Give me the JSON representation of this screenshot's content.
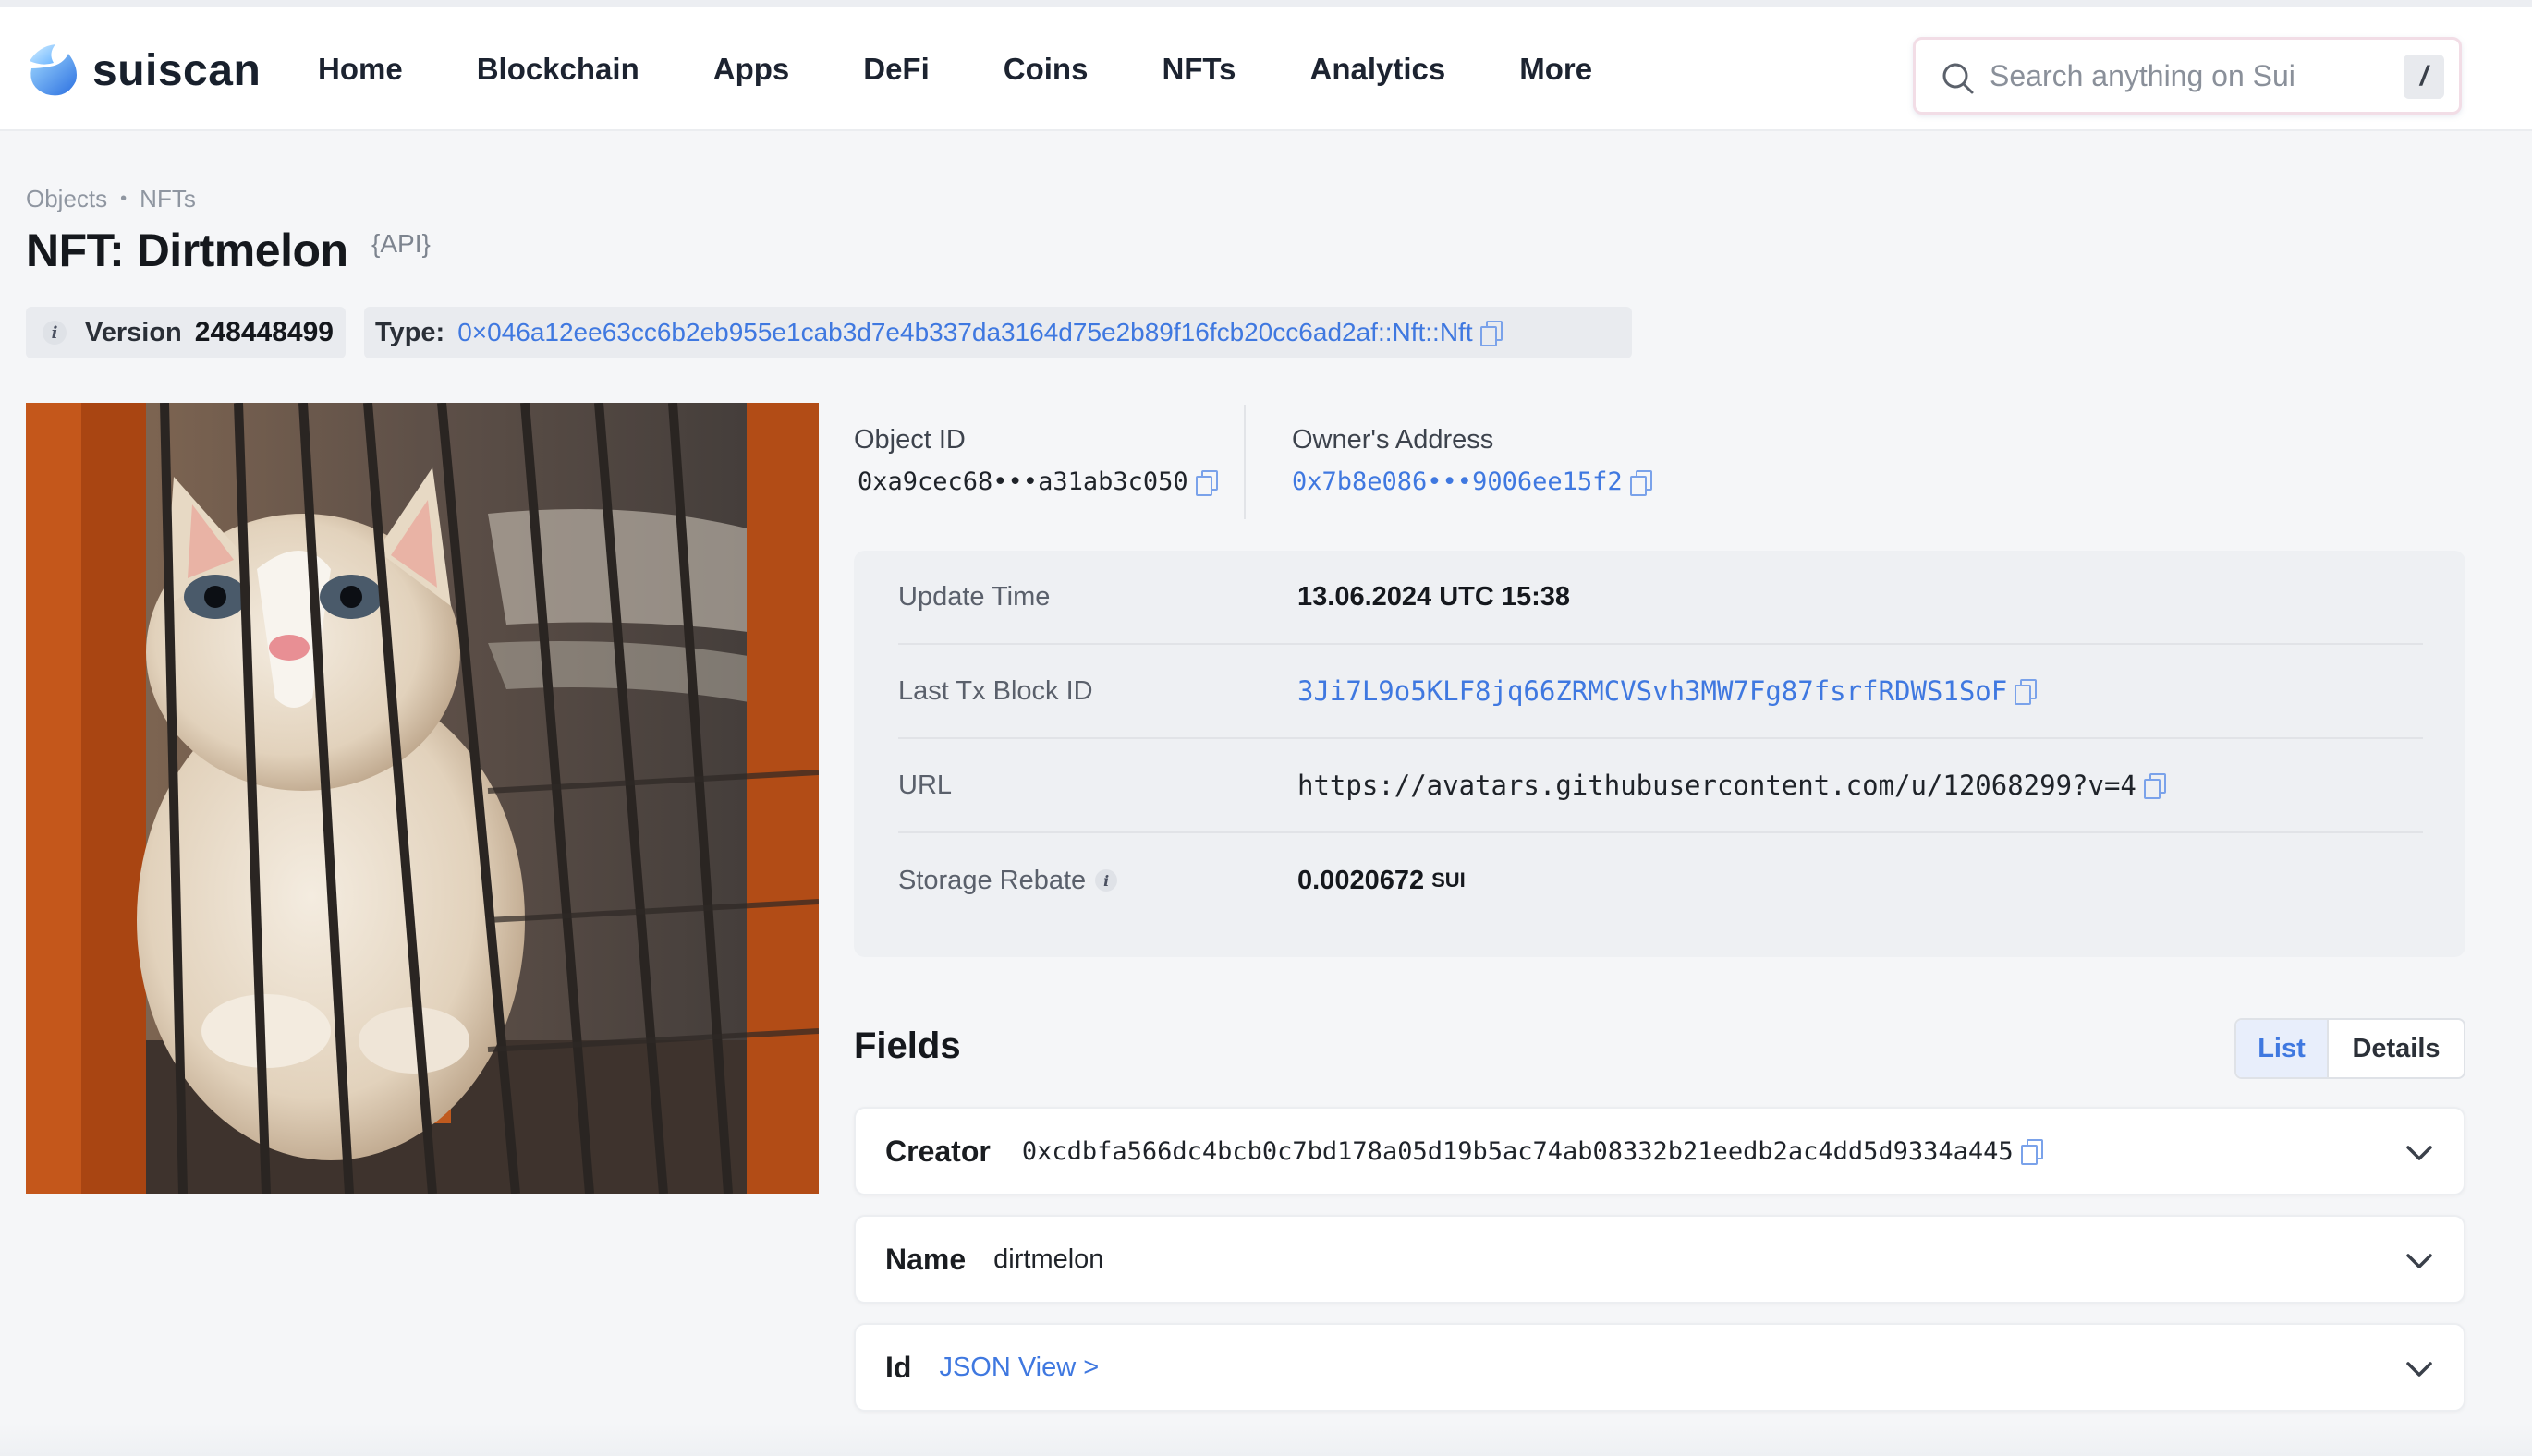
{
  "brand": {
    "name": "suiscan",
    "accent": "#3f78e0"
  },
  "nav": [
    "Home",
    "Blockchain",
    "Apps",
    "DeFi",
    "Coins",
    "NFTs",
    "Analytics",
    "More"
  ],
  "search": {
    "placeholder": "Search anything on Sui",
    "shortcut": "/"
  },
  "breadcrumb": [
    "Objects",
    "NFTs"
  ],
  "page": {
    "title": "NFT: Dirtmelon",
    "api_tag": "{API}"
  },
  "version": {
    "label": "Version",
    "value": "248448499"
  },
  "type": {
    "label": "Type:",
    "value": "0×046a12ee63cc6b2eb955e1cab3d7e4b337da3164d75e2b89f16fcb20cc6ad2af::Nft::Nft"
  },
  "object": {
    "label": "Object ID",
    "value": "0xa9cec68•••a31ab3c050"
  },
  "owner": {
    "label": "Owner's Address",
    "value": "0x7b8e086•••9006ee15f2"
  },
  "details": {
    "update_time": {
      "label": "Update Time",
      "value": "13.06.2024 UTC 15:38"
    },
    "last_tx": {
      "label": "Last Tx Block ID",
      "value": "3Ji7L9o5KLF8jq66ZRMCVSvh3MW7Fg87fsrfRDWS1SoF"
    },
    "url": {
      "label": "URL",
      "value": "https://avatars.githubusercontent.com/u/12068299?v=4"
    },
    "storage_rebate": {
      "label": "Storage Rebate",
      "value": "0.0020672",
      "unit": "SUI"
    }
  },
  "fields": {
    "title": "Fields",
    "toggle": [
      "List",
      "Details"
    ],
    "items": [
      {
        "name": "Creator",
        "value": "0xcdbfa566dc4bcb0c7bd178a05d19b5ac74ab08332b21eedb2ac4dd5d9334a445"
      },
      {
        "name": "Name",
        "value": "dirtmelon"
      },
      {
        "name": "Id",
        "value": "JSON View >"
      }
    ]
  }
}
